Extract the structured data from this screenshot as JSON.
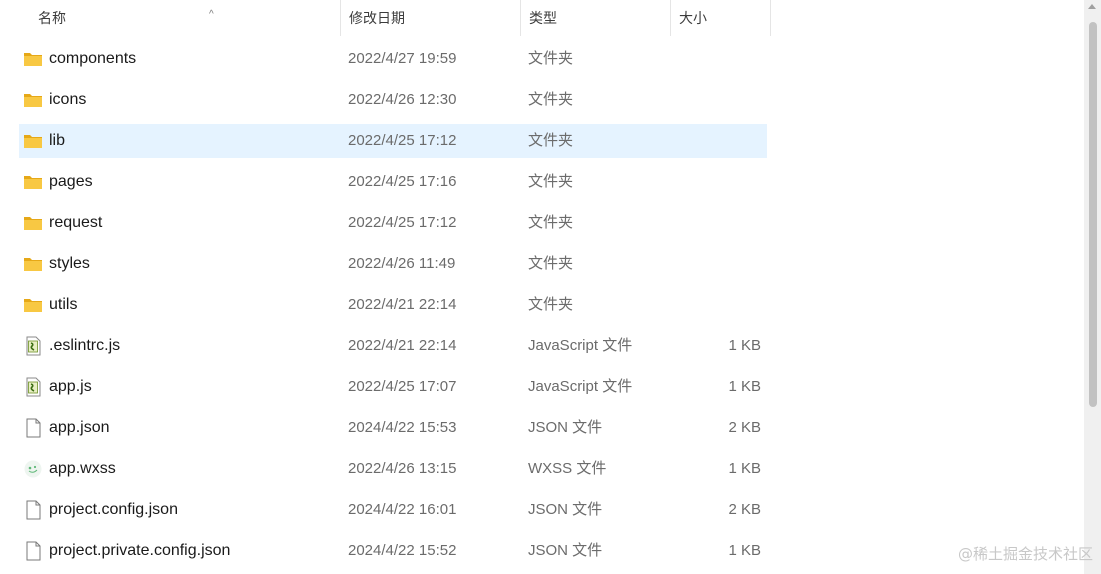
{
  "columns": {
    "name": "名称",
    "modified": "修改日期",
    "type": "类型",
    "size": "大小"
  },
  "files": [
    {
      "name": "components",
      "date": "2022/4/27 19:59",
      "type": "文件夹",
      "size": "",
      "icon": "folder-icon"
    },
    {
      "name": "icons",
      "date": "2022/4/26 12:30",
      "type": "文件夹",
      "size": "",
      "icon": "folder-icon"
    },
    {
      "name": "lib",
      "date": "2022/4/25 17:12",
      "type": "文件夹",
      "size": "",
      "icon": "folder-icon"
    },
    {
      "name": "pages",
      "date": "2022/4/25 17:16",
      "type": "文件夹",
      "size": "",
      "icon": "folder-icon"
    },
    {
      "name": "request",
      "date": "2022/4/25 17:12",
      "type": "文件夹",
      "size": "",
      "icon": "folder-icon"
    },
    {
      "name": "styles",
      "date": "2022/4/26 11:49",
      "type": "文件夹",
      "size": "",
      "icon": "folder-icon"
    },
    {
      "name": "utils",
      "date": "2022/4/21 22:14",
      "type": "文件夹",
      "size": "",
      "icon": "folder-icon"
    },
    {
      "name": ".eslintrc.js",
      "date": "2022/4/21 22:14",
      "type": "JavaScript 文件",
      "size": "1 KB",
      "icon": "javascript-file-icon"
    },
    {
      "name": "app.js",
      "date": "2022/4/25 17:07",
      "type": "JavaScript 文件",
      "size": "1 KB",
      "icon": "javascript-file-icon"
    },
    {
      "name": "app.json",
      "date": "2024/4/22 15:53",
      "type": "JSON 文件",
      "size": "2 KB",
      "icon": "blank-file-icon"
    },
    {
      "name": "app.wxss",
      "date": "2022/4/26 13:15",
      "type": "WXSS 文件",
      "size": "1 KB",
      "icon": "wxss-file-icon"
    },
    {
      "name": "project.config.json",
      "date": "2024/4/22 16:01",
      "type": "JSON 文件",
      "size": "2 KB",
      "icon": "blank-file-icon"
    },
    {
      "name": "project.private.config.json",
      "date": "2024/4/22 15:52",
      "type": "JSON 文件",
      "size": "1 KB",
      "icon": "blank-file-icon"
    }
  ],
  "selected_file": "lib",
  "watermark": "@稀土掘金技术社区",
  "colors": {
    "selection": "#e5f3ff",
    "folder": "#f8c843",
    "folder_dark": "#e6a817"
  }
}
